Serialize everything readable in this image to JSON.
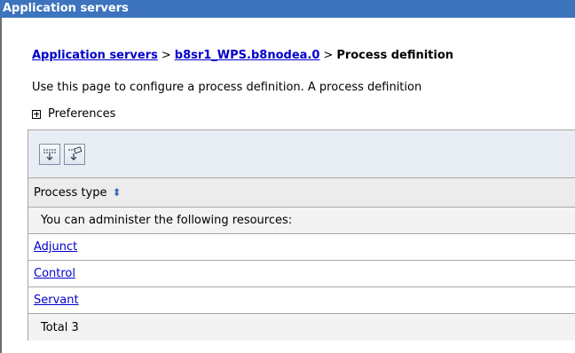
{
  "window": {
    "title": "Application servers"
  },
  "breadcrumb": {
    "link1": "Application servers",
    "sep1": ">",
    "link2": "b8sr1_WPS.b8nodea.0",
    "sep2": ">",
    "current": "Process definition"
  },
  "description": "Use this page to configure a process definition. A process definition",
  "preferences": {
    "label": "Preferences"
  },
  "toolbar": {
    "buttons": [
      "select-all-icon",
      "deselect-all-icon"
    ]
  },
  "table": {
    "header": "Process type",
    "info": "You can administer the following resources:",
    "rows": [
      "Adjunct",
      "Control",
      "Servant"
    ],
    "total": "Total 3"
  },
  "colors": {
    "titlebar": "#3e73bd",
    "link": "#0000cc"
  }
}
